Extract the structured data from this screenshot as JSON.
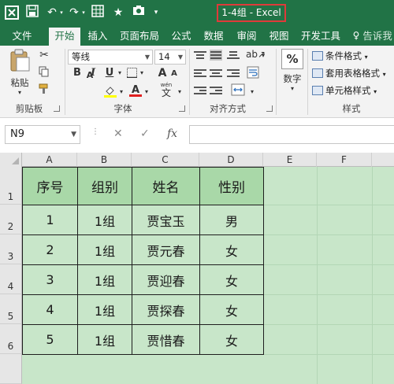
{
  "window": {
    "title": "1-4组 - Excel"
  },
  "tabs": [
    {
      "label": "文件"
    },
    {
      "label": "开始"
    },
    {
      "label": "插入"
    },
    {
      "label": "页面布局"
    },
    {
      "label": "公式"
    },
    {
      "label": "数据"
    },
    {
      "label": "审阅"
    },
    {
      "label": "视图"
    },
    {
      "label": "开发工具"
    },
    {
      "label": "告诉我"
    }
  ],
  "ribbon": {
    "clipboard": {
      "paste_label": "粘贴",
      "group_label": "剪贴板"
    },
    "font": {
      "name": "等线",
      "size": "14",
      "bold": "B",
      "italic": "I",
      "underline": "U",
      "grow": "A",
      "shrink": "A",
      "font_color": "A",
      "wen": "wén",
      "wen_char": "文",
      "group_label": "字体"
    },
    "alignment": {
      "group_label": "对齐方式"
    },
    "number": {
      "percent": "%",
      "label": "数字"
    },
    "styles": {
      "conditional": "条件格式",
      "table_format": "套用表格格式",
      "cell_style": "单元格样式",
      "group_label": "样式"
    }
  },
  "formula_bar": {
    "name_box": "N9",
    "cancel": "✕",
    "confirm": "✓",
    "fx": "fx",
    "value": ""
  },
  "sheet": {
    "columns": [
      "A",
      "B",
      "C",
      "D",
      "E",
      "F"
    ],
    "rows": [
      "1",
      "2",
      "3",
      "4",
      "5",
      "6"
    ],
    "header": [
      "序号",
      "组别",
      "姓名",
      "性别"
    ],
    "data": [
      [
        "1",
        "1组",
        "贾宝玉",
        "男"
      ],
      [
        "2",
        "1组",
        "贾元春",
        "女"
      ],
      [
        "3",
        "1组",
        "贾迎春",
        "女"
      ],
      [
        "4",
        "1组",
        "贾探春",
        "女"
      ],
      [
        "5",
        "1组",
        "贾惜春",
        "女"
      ]
    ]
  },
  "colors": {
    "accent": "#217346",
    "header_fill": "#a9d8a8",
    "sheet_fill": "#c8e6c9",
    "title_highlight": "#e03a3a"
  }
}
